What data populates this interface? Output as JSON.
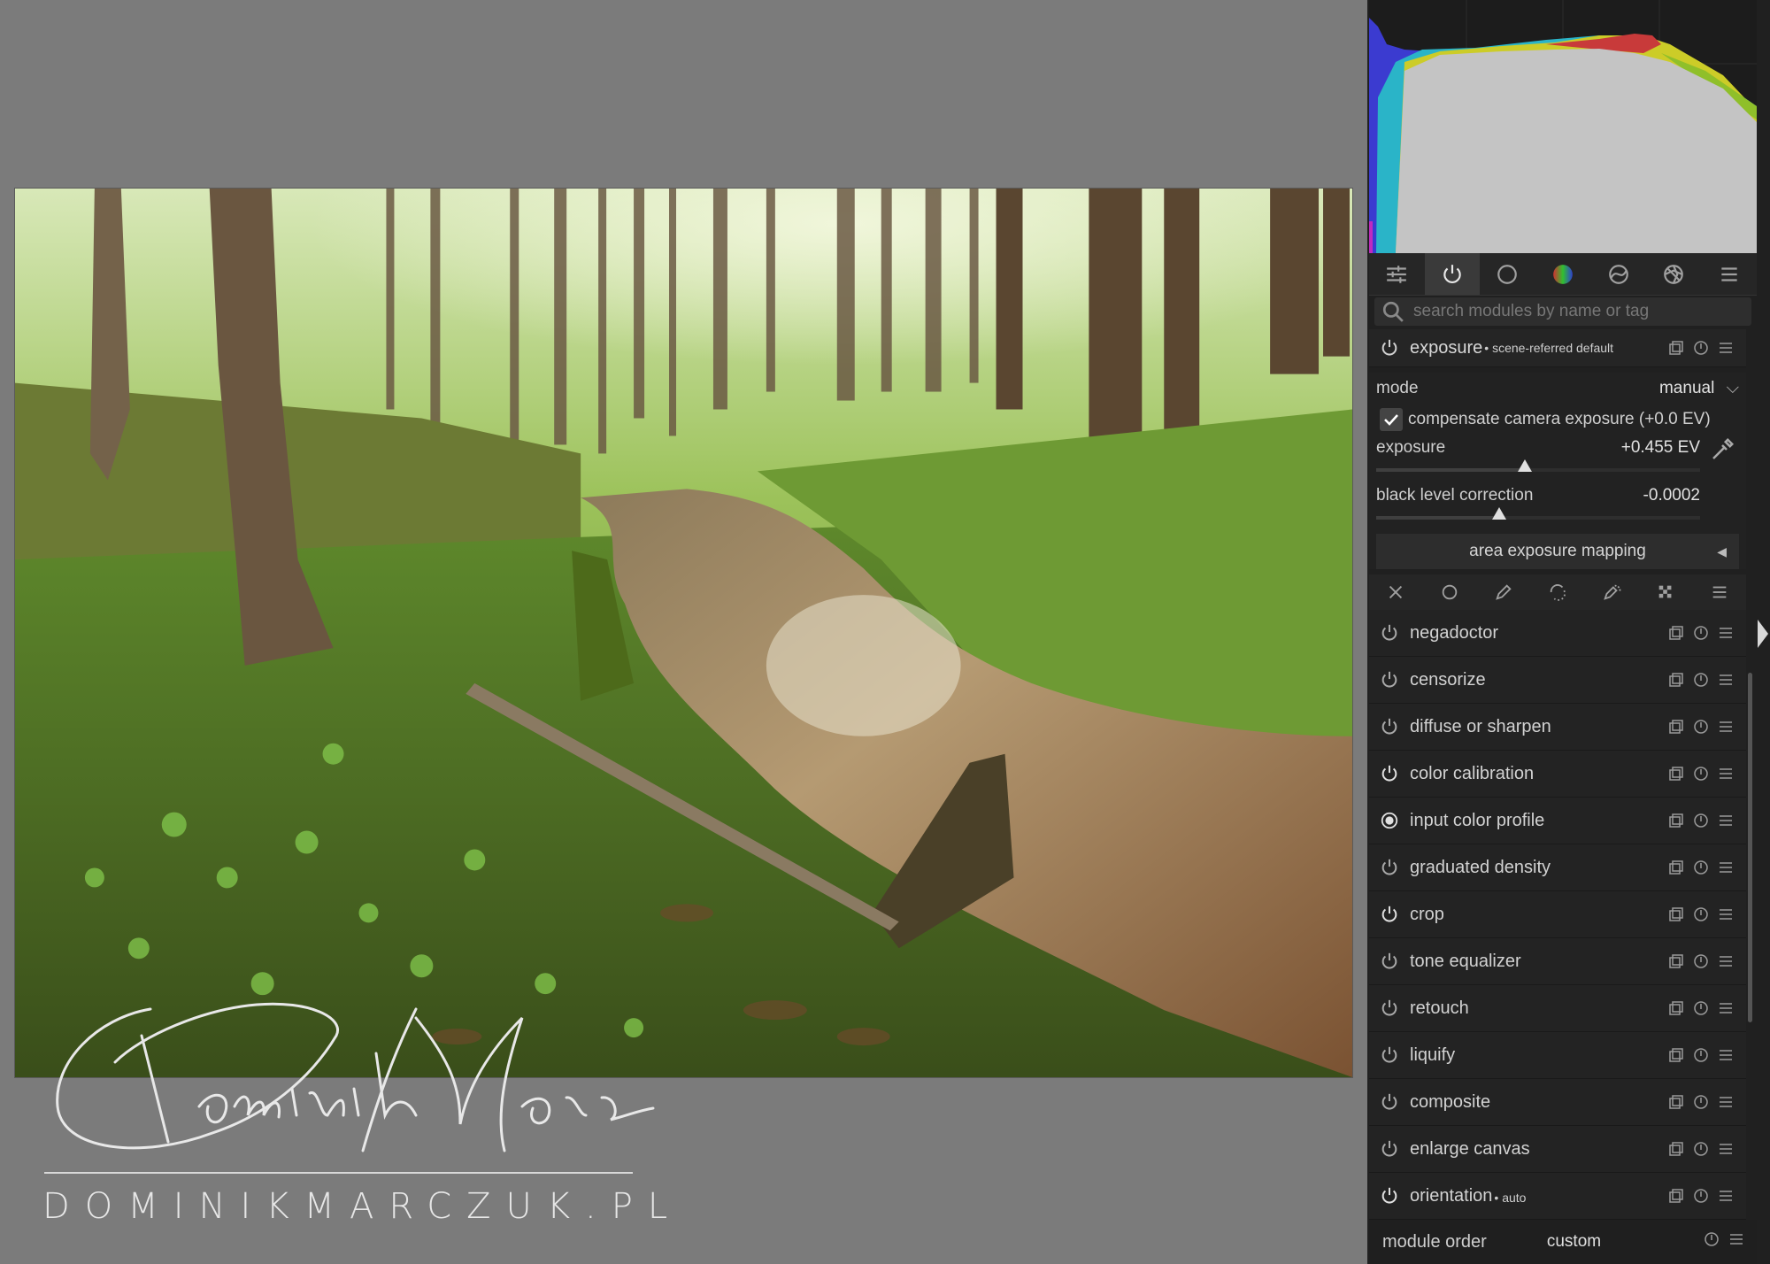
{
  "watermark": {
    "signature": "Dominik Marczuk",
    "url": "DOMINIKMARCZUK.PL"
  },
  "histogram": {
    "channels_colors": {
      "red": "#c83a3a",
      "green": "#8fbf2a",
      "blue": "#3b3bd0",
      "cyan": "#2ab4c8",
      "yellow": "#cccc28",
      "gray": "#c4c4c4"
    }
  },
  "group_tabs": [
    {
      "name": "quick-access-icon"
    },
    {
      "name": "active-modules-icon"
    },
    {
      "name": "base-group-icon"
    },
    {
      "name": "color-group-icon"
    },
    {
      "name": "correct-group-icon"
    },
    {
      "name": "effects-group-icon"
    },
    {
      "name": "presets-menu-icon"
    }
  ],
  "search": {
    "placeholder": "search modules by name or tag"
  },
  "exposure_module": {
    "name": "exposure",
    "preset": "• scene-referred default",
    "mode_label": "mode",
    "mode_value": "manual",
    "compensate_label": "compensate camera exposure (+0.0 EV)",
    "compensate_checked": true,
    "exposure_label": "exposure",
    "exposure_value": "+0.455 EV",
    "black_label": "black level correction",
    "black_value": "-0.0002",
    "area_button": "area exposure mapping"
  },
  "mask_bar_icons": [
    "off-icon",
    "uniform-mask-icon",
    "drawn-mask-icon",
    "parametric-mask-icon",
    "drawn-parametric-icon",
    "raster-mask-icon",
    "blend-menu-icon"
  ],
  "modules": [
    {
      "name": "negadoctor",
      "sub": "",
      "on": false
    },
    {
      "name": "censorize",
      "sub": "",
      "on": false
    },
    {
      "name": "diffuse or sharpen",
      "sub": "",
      "on": false
    },
    {
      "name": "color calibration",
      "sub": "",
      "on": true
    },
    {
      "name": "input color profile",
      "sub": "",
      "on": true,
      "forced": true
    },
    {
      "name": "graduated density",
      "sub": "",
      "on": false
    },
    {
      "name": "crop",
      "sub": "",
      "on": true
    },
    {
      "name": "tone equalizer",
      "sub": "",
      "on": false
    },
    {
      "name": "retouch",
      "sub": "",
      "on": false
    },
    {
      "name": "liquify",
      "sub": "",
      "on": false
    },
    {
      "name": "composite",
      "sub": "",
      "on": false
    },
    {
      "name": "enlarge canvas",
      "sub": "",
      "on": false
    },
    {
      "name": "orientation",
      "sub": "• auto",
      "on": true
    }
  ],
  "module_order": {
    "label": "module order",
    "value": "custom"
  }
}
